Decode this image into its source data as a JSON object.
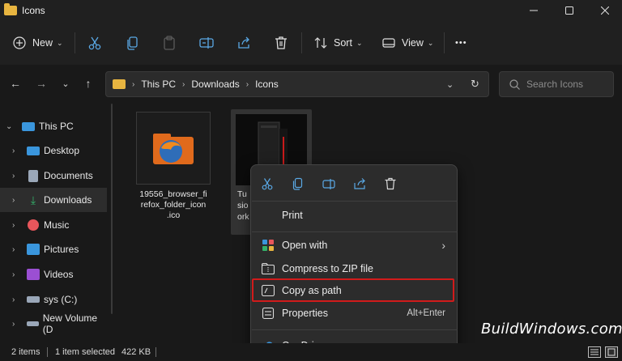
{
  "window": {
    "title": "Icons",
    "folder_color": "#e8b540",
    "controls": [
      "minimize-icon",
      "maximize-icon",
      "close-icon"
    ]
  },
  "toolbar": {
    "new_label": "New",
    "sort_label": "Sort",
    "view_label": "View",
    "more_label": "•••",
    "icons": [
      "cut-icon",
      "copy-icon",
      "paste-icon",
      "rename-icon",
      "share-icon",
      "delete-icon"
    ]
  },
  "address": {
    "crumbs": [
      "This PC",
      "Downloads",
      "Icons"
    ]
  },
  "search": {
    "placeholder": "Search Icons"
  },
  "sidebar": {
    "items": [
      {
        "label": "This PC",
        "icon": "monitor-icon",
        "color": "#3a96dd"
      },
      {
        "label": "Desktop",
        "icon": "desktop-icon",
        "color": "#3a96dd"
      },
      {
        "label": "Documents",
        "icon": "documents-icon",
        "color": "#9aa7b8"
      },
      {
        "label": "Downloads",
        "icon": "download-icon",
        "color": "#34b26b"
      },
      {
        "label": "Music",
        "icon": "music-icon",
        "color": "#e8565b"
      },
      {
        "label": "Pictures",
        "icon": "pictures-icon",
        "color": "#3a96dd"
      },
      {
        "label": "Videos",
        "icon": "videos-icon",
        "color": "#9b4fd3"
      },
      {
        "label": "sys (C:)",
        "icon": "drive-icon",
        "color": "#9aa7b8"
      },
      {
        "label": "New Volume (D",
        "icon": "drive-icon",
        "color": "#9aa7b8"
      }
    ]
  },
  "files": [
    {
      "name": "19556_browser_firefox_folder_icon.ico",
      "name_lines": [
        "19556_browser_fi",
        "refox_folder_icon",
        ".ico"
      ]
    },
    {
      "name": "Tu sio ork",
      "name_lines": [
        "Tu",
        "sio",
        "ork"
      ]
    }
  ],
  "context_menu": {
    "quick_icons": [
      "cut-icon",
      "copy-icon",
      "rename-icon",
      "share-icon",
      "delete-icon"
    ],
    "print_label": "Print",
    "open_with_label": "Open with",
    "compress_label": "Compress to ZIP file",
    "copy_path_label": "Copy as path",
    "properties_label": "Properties",
    "properties_shortcut": "Alt+Enter",
    "onedrive_label": "OneDrive",
    "highlight_color": "#d11b1b"
  },
  "status": {
    "items_count": "2 items",
    "selected": "1 item selected",
    "size": "422 KB"
  },
  "watermark": "BuildWindows.com"
}
